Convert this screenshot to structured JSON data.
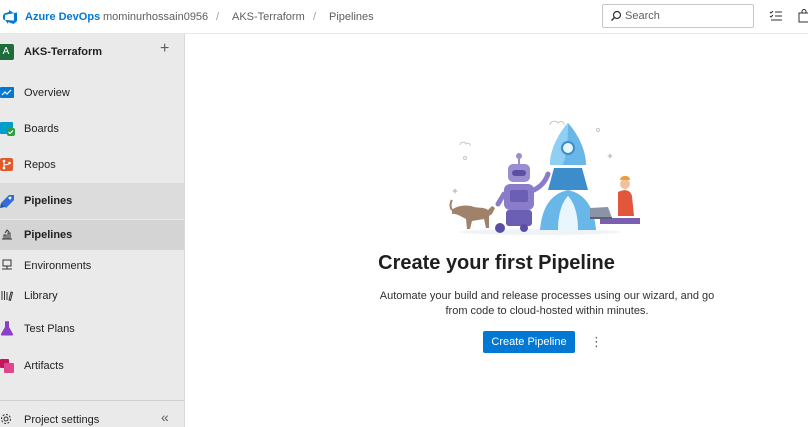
{
  "header": {
    "brand": "Azure DevOps",
    "breadcrumbs": [
      "mominurhossain0956",
      "AKS-Terraform",
      "Pipelines"
    ],
    "separator": "/",
    "search_placeholder": "Search"
  },
  "sidebar": {
    "project_initial": "A",
    "project_name": "AKS-Terraform",
    "add_symbol": "+",
    "items": [
      {
        "label": "Overview",
        "icon": "overview-icon"
      },
      {
        "label": "Boards",
        "icon": "boards-icon"
      },
      {
        "label": "Repos",
        "icon": "repos-icon"
      },
      {
        "label": "Pipelines",
        "icon": "pipelines-icon"
      },
      {
        "label": "Test Plans",
        "icon": "test-plans-icon"
      },
      {
        "label": "Artifacts",
        "icon": "artifacts-icon"
      }
    ],
    "sub_items": [
      {
        "label": "Pipelines",
        "icon": "pipeline-sub-icon"
      },
      {
        "label": "Environments",
        "icon": "environments-icon"
      },
      {
        "label": "Library",
        "icon": "library-icon"
      }
    ],
    "footer_label": "Project settings",
    "collapse_symbol": "«"
  },
  "main": {
    "title": "Create your first Pipeline",
    "description": "Automate your build and release processes using our wizard, and go from code to cloud-hosted within minutes.",
    "cta_label": "Create Pipeline",
    "more_symbol": "⋮"
  },
  "colors": {
    "accent": "#0078d4",
    "project_avatar": "#1f6c3b"
  }
}
